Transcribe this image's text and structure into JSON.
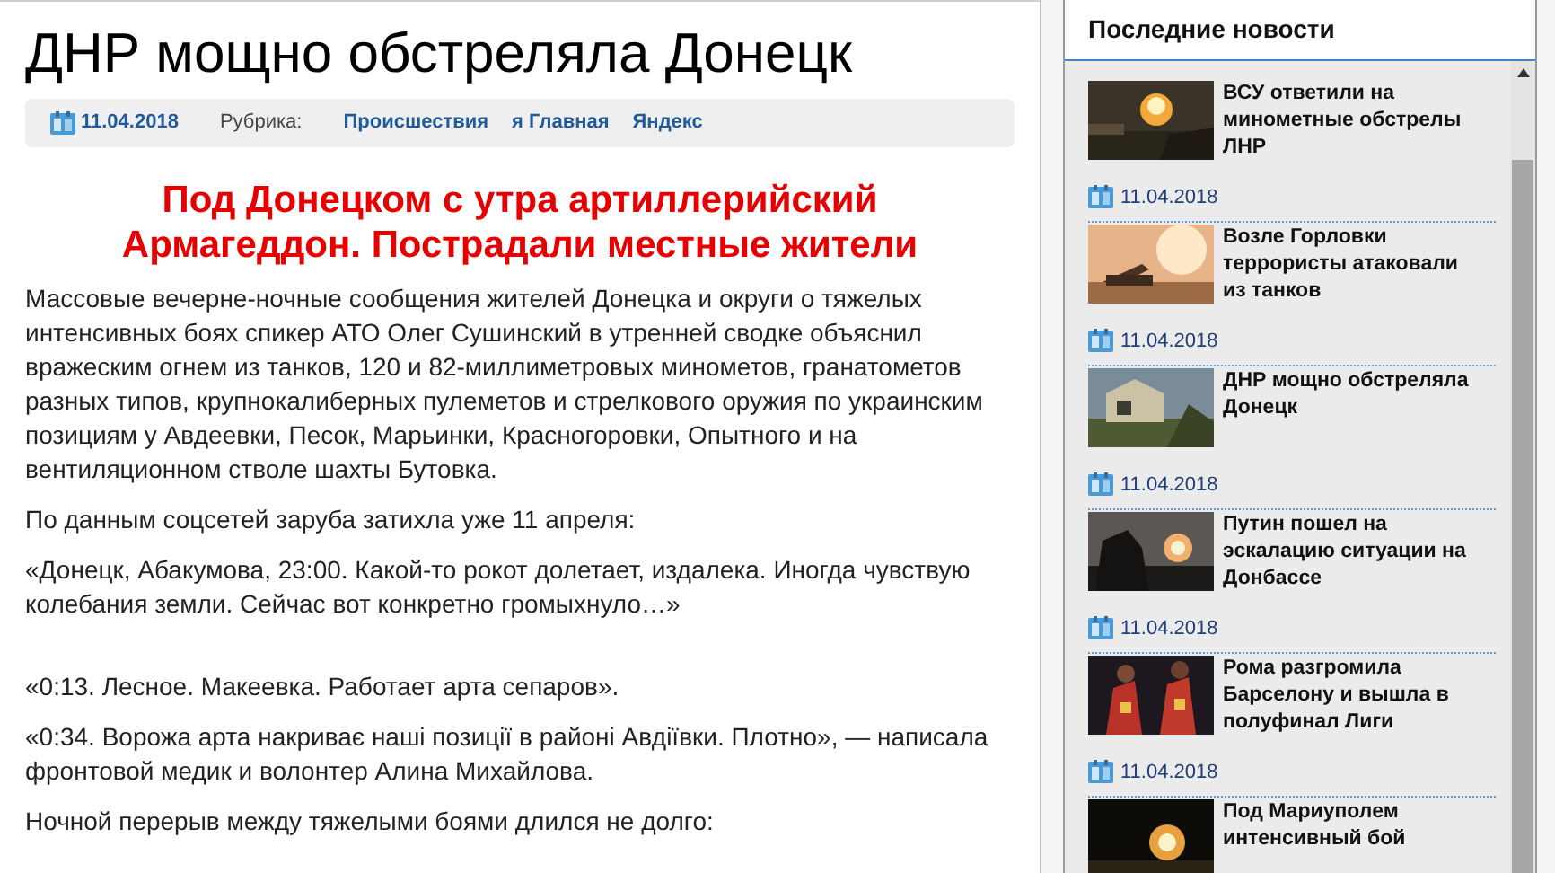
{
  "article": {
    "title": "ДНР мощно обстреляла Донецк",
    "date": "11.04.2018",
    "rubric_label": "Рубрика:",
    "rubrics": [
      "Происшествия",
      "я Главная",
      "Яндекс"
    ],
    "headline": "Под Донецком с утра артиллерийский Армагеддон. Пострадали местные жители",
    "paragraphs": [
      "Массовые вечерне-ночные сообщения жителей Донецка и округи о тяжелых интенсивных боях спикер АТО Олег Сушинский в утренней сводке объяснил вражеским огнем из танков, 120 и 82-миллиметровых минометов, гранатометов разных типов, крупнокалиберных пулеметов и стрелкового оружия по украинским позициям у Авдеевки, Песок, Марьинки, Красногоровки, Опытного и на вентиляционном стволе шахты Бутовка.",
      "По данным соцсетей заруба затихла уже 11 апреля:",
      "«Донецк, Абакумова, 23:00. Какой-то рокот долетает, издалека. Иногда чувствую колебания земли. Сейчас вот конкретно громыхнуло…»",
      "«0:13. Лесное. Макеевка. Работает арта сепаров».",
      "«0:34. Ворожа арта накриває наші позиції в районі Авдіївки. Плотно», — написала фронтовой медик и волонтер Алина Михайлова.",
      "Ночной перерыв между тяжелыми боями длился не долго:"
    ]
  },
  "sidebar": {
    "title": "Последние новости",
    "items": [
      {
        "title": "ВСУ ответили на минометные обстрелы ЛНР",
        "date": "11.04.2018"
      },
      {
        "title": "Возле Горловки террористы атаковали из танков",
        "date": "11.04.2018"
      },
      {
        "title": "ДНР мощно обстреляла Донецк",
        "date": "11.04.2018"
      },
      {
        "title": "Путин пошел на эскалацию ситуации на Донбассе",
        "date": "11.04.2018"
      },
      {
        "title": "Рома разгромила Барселону и вышла в полуфинал Лиги",
        "date": "11.04.2018"
      },
      {
        "title": "Под Мариуполем интенсивный бой"
      }
    ]
  }
}
